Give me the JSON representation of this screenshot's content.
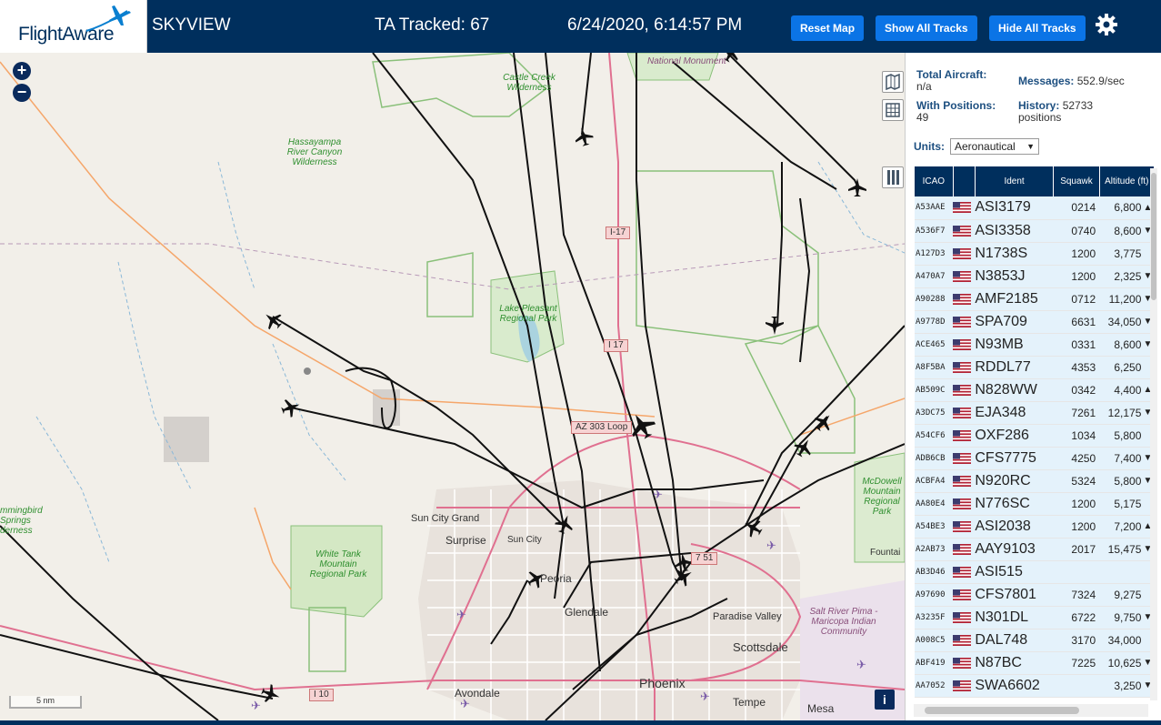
{
  "header": {
    "logo_text": "FlightAware",
    "app_name": "SKYVIEW",
    "tracked": "TA Tracked: 67",
    "datetime": "6/24/2020, 6:14:57 PM",
    "buttons": {
      "reset": "Reset Map",
      "show": "Show All Tracks",
      "hide": "Hide All Tracks"
    }
  },
  "map": {
    "zoom_in": "+",
    "zoom_out": "−",
    "scale": "5 nm",
    "info": "i",
    "labels": {
      "national_monument": "National Monument",
      "castle_creek": "Castle Creek Wilderness",
      "hassayampa": "Hassayampa River Canyon Wilderness",
      "lake_pleasant": "Lake Pleasant Regional Park",
      "white_tank": "White Tank Mountain Regional Park",
      "hummingbird": "mmingbird Springs derness",
      "mcdowell": "McDowell Mountain Regional Park",
      "salt_river": "Salt River Pima - Maricopa Indian Community",
      "sun_city_grand": "Sun City Grand",
      "surprise": "Surprise",
      "sun_city": "Sun City",
      "peoria": "Peoria",
      "glendale": "Glendale",
      "paradise_valley": "Paradise Valley",
      "scottsdale": "Scottsdale",
      "phoenix": "Phoenix",
      "avondale": "Avondale",
      "tempe": "Tempe",
      "mesa": "Mesa",
      "fountain": "Fountai"
    },
    "shields": {
      "i17a": "I-17",
      "i17b": "I 17",
      "loop303": "AZ 303 Loop",
      "i10": "I 10",
      "loop101": "7 51"
    }
  },
  "panel": {
    "total_label": "Total Aircraft:",
    "total_value": "n/a",
    "messages_label": "Messages:",
    "messages_value": "552.9/sec",
    "positions_label": "With Positions:",
    "positions_value": "49",
    "history_label": "History:",
    "history_value": "52733 positions",
    "units_label": "Units:",
    "units_value": "Aeronautical",
    "columns": {
      "icao": "ICAO",
      "ident": "Ident",
      "squawk": "Squawk",
      "altitude": "Altitude (ft)"
    },
    "rows": [
      {
        "icao": "A53AAE",
        "ident": "ASI3179",
        "squawk": "0214",
        "alt": "6,800",
        "arrow": "▲"
      },
      {
        "icao": "A536F7",
        "ident": "ASI3358",
        "squawk": "0740",
        "alt": "8,600",
        "arrow": "▼"
      },
      {
        "icao": "A127D3",
        "ident": "N1738S",
        "squawk": "1200",
        "alt": "3,775",
        "arrow": ""
      },
      {
        "icao": "A470A7",
        "ident": "N3853J",
        "squawk": "1200",
        "alt": "2,325",
        "arrow": "▼"
      },
      {
        "icao": "A90288",
        "ident": "AMF2185",
        "squawk": "0712",
        "alt": "11,200",
        "arrow": "▼"
      },
      {
        "icao": "A9778D",
        "ident": "SPA709",
        "squawk": "6631",
        "alt": "34,050",
        "arrow": "▼"
      },
      {
        "icao": "ACE465",
        "ident": "N93MB",
        "squawk": "0331",
        "alt": "8,600",
        "arrow": "▼"
      },
      {
        "icao": "A8F5BA",
        "ident": "RDDL77",
        "squawk": "4353",
        "alt": "6,250",
        "arrow": ""
      },
      {
        "icao": "AB509C",
        "ident": "N828WW",
        "squawk": "0342",
        "alt": "4,400",
        "arrow": "▲"
      },
      {
        "icao": "A3DC75",
        "ident": "EJA348",
        "squawk": "7261",
        "alt": "12,175",
        "arrow": "▼"
      },
      {
        "icao": "A54CF6",
        "ident": "OXF286",
        "squawk": "1034",
        "alt": "5,800",
        "arrow": ""
      },
      {
        "icao": "ADB6CB",
        "ident": "CFS7775",
        "squawk": "4250",
        "alt": "7,400",
        "arrow": "▼"
      },
      {
        "icao": "ACBFA4",
        "ident": "N920RC",
        "squawk": "5324",
        "alt": "5,800",
        "arrow": "▼"
      },
      {
        "icao": "AA80E4",
        "ident": "N776SC",
        "squawk": "1200",
        "alt": "5,175",
        "arrow": ""
      },
      {
        "icao": "A54BE3",
        "ident": "ASI2038",
        "squawk": "1200",
        "alt": "7,200",
        "arrow": "▲"
      },
      {
        "icao": "A2AB73",
        "ident": "AAY9103",
        "squawk": "2017",
        "alt": "15,475",
        "arrow": "▼"
      },
      {
        "icao": "AB3D46",
        "ident": "ASI515",
        "squawk": "",
        "alt": "",
        "arrow": ""
      },
      {
        "icao": "A97690",
        "ident": "CFS7801",
        "squawk": "7324",
        "alt": "9,275",
        "arrow": ""
      },
      {
        "icao": "A3235F",
        "ident": "N301DL",
        "squawk": "6722",
        "alt": "9,750",
        "arrow": "▼"
      },
      {
        "icao": "A008C5",
        "ident": "DAL748",
        "squawk": "3170",
        "alt": "34,000",
        "arrow": ""
      },
      {
        "icao": "ABF419",
        "ident": "N87BC",
        "squawk": "7225",
        "alt": "10,625",
        "arrow": "▼"
      },
      {
        "icao": "AA7052",
        "ident": "SWA6602",
        "squawk": "",
        "alt": "3,250",
        "arrow": "▼"
      }
    ]
  },
  "colors": {
    "header_bg": "#002f5d",
    "button_bg": "#0b74e6",
    "row_highlight": "#e4f2fb"
  },
  "icons": [
    "plane-logo-icon",
    "gear-icon",
    "layers-icon",
    "grid-icon",
    "columns-icon",
    "us-flag-icon",
    "aircraft-icon"
  ]
}
